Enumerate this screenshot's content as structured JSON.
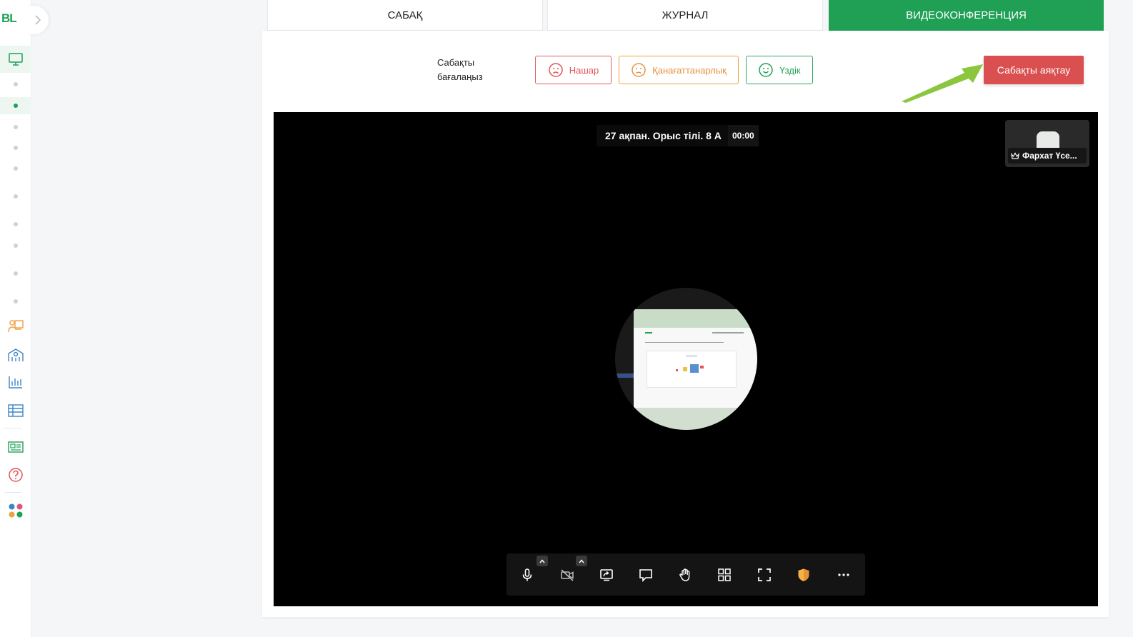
{
  "sidebar": {
    "logo": "BL",
    "icons": [
      "monitor-icon",
      "teacher-icon",
      "school-icon",
      "chart-icon",
      "table-icon",
      "newspaper-icon",
      "help-icon",
      "apps-icon"
    ]
  },
  "tabs": [
    {
      "label": "САБАҚ"
    },
    {
      "label": "ЖУРНАЛ"
    },
    {
      "label": "ВИДЕОКОНФЕРЕНЦИЯ"
    }
  ],
  "rating": {
    "label": "Сабақты бағалаңыз",
    "bad": "Нашар",
    "ok": "Қанағаттанарлық",
    "good": "Үздік"
  },
  "end_button": "Сабақты аяқтау",
  "conference": {
    "title": "27 ақпан. Орыс тілі. 8 А",
    "timer": "00:00",
    "participant": "Фархат Үсе..."
  },
  "colors": {
    "accent": "#1fa055",
    "danger": "#da4f4f",
    "warning": "#e8923a",
    "arrow": "#8cc63f"
  }
}
